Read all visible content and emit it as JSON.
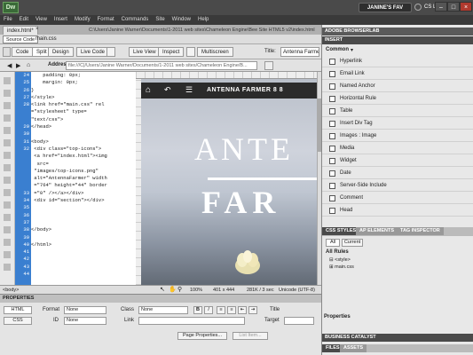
{
  "app": {
    "logo": "Dw",
    "workspace": "JANINE'S FAV",
    "cs_live": "CS Live",
    "window_controls": [
      "–",
      "□",
      "×"
    ]
  },
  "menu": [
    "File",
    "Edit",
    "View",
    "Insert",
    "Modify",
    "Format",
    "Commands",
    "Site",
    "Window",
    "Help"
  ],
  "doc": {
    "tab": "index.html*",
    "path": "C:\\Users\\Janine Warner\\Documents\\1-2011 web sites\\Chameleon Engine\\Bee Site HTML5 v2\\index.html",
    "source_code_btn": "Source Code",
    "related_file": "main.css"
  },
  "toolbar": {
    "code": "Code",
    "split": "Split",
    "design": "Design",
    "live_code": "Live Code",
    "live_view": "Live View",
    "inspect": "Inspect",
    "multiscreen": "Multiscreen",
    "title_label": "Title:",
    "title_value": "Antenna Farmer"
  },
  "address": {
    "label": "Address:",
    "value": "file:///C|/Users/Janine Warner/Documents/1-2011 web sites/Chameleon Engine/B..."
  },
  "code": {
    "line_numbers": [
      "24",
      "25",
      "26",
      "27",
      "28",
      "",
      "",
      "29",
      "30",
      "31",
      "32",
      "",
      "",
      "",
      "",
      "",
      "33",
      "34",
      "35",
      "36",
      "37",
      "38",
      "39",
      "40",
      "41",
      "42",
      "43",
      "44"
    ],
    "lines": [
      "    padding: 0px;",
      "    margin: 0px;",
      "}",
      "</style>",
      "<link href=\"main.css\" rel",
      "=\"stylesheet\" type=",
      "\"text/css\">",
      "</head>",
      "",
      "<body>",
      " <div class=\"top-icons\">",
      " <a href=\"index.html\"><img",
      "  src=",
      " \"images/top-icons.png\"",
      " alt=\"AntennaFarmer\" width",
      " =\"764\" height=\"44\" border",
      " =\"0\" /></a></div>",
      " <div id=\"section\"></div>",
      "",
      "",
      "",
      "</body>",
      "",
      "</html>"
    ]
  },
  "design_view": {
    "nav_title": "ANTENNA FARMER 8 8",
    "hero_line1": "ANTE",
    "hero_line2": "FAR"
  },
  "statusbar": {
    "tag": "<body>",
    "zoom": "100%",
    "size": "401 x 444",
    "weight": "281K / 3 sec",
    "encoding": "Unicode (UTF-8)"
  },
  "properties": {
    "header": "PROPERTIES",
    "html_btn": "HTML",
    "css_btn": "CSS",
    "format_label": "Format",
    "format_value": "None",
    "id_label": "ID",
    "id_value": "None",
    "class_label": "Class",
    "class_value": "None",
    "link_label": "Link",
    "bold": "B",
    "italic": "I",
    "title_label": "Title",
    "target_label": "Target",
    "page_properties": "Page Properties...",
    "list_item": "List Item..."
  },
  "right": {
    "browserlab": "ADOBE BROWSERLAB",
    "insert": "INSERT",
    "category": "Common",
    "insert_items": [
      "Hyperlink",
      "Email Link",
      "Named Anchor",
      "Horizontal Rule",
      "Table",
      "Insert Div Tag",
      "Images : Image",
      "Media",
      "Widget",
      "Date",
      "Server-Side Include",
      "Comment",
      "Head"
    ],
    "css_tabs": [
      "CSS STYLES",
      "AP ELEMENTS",
      "TAG INSPECTOR"
    ],
    "css_modes": [
      "All",
      "Current"
    ],
    "all_rules": "All Rules",
    "rules": [
      "<style>",
      "main.css"
    ],
    "properties": "Properties",
    "business": "BUSINESS CATALYST",
    "bottom_tabs": [
      "FILES",
      "ASSETS"
    ]
  }
}
